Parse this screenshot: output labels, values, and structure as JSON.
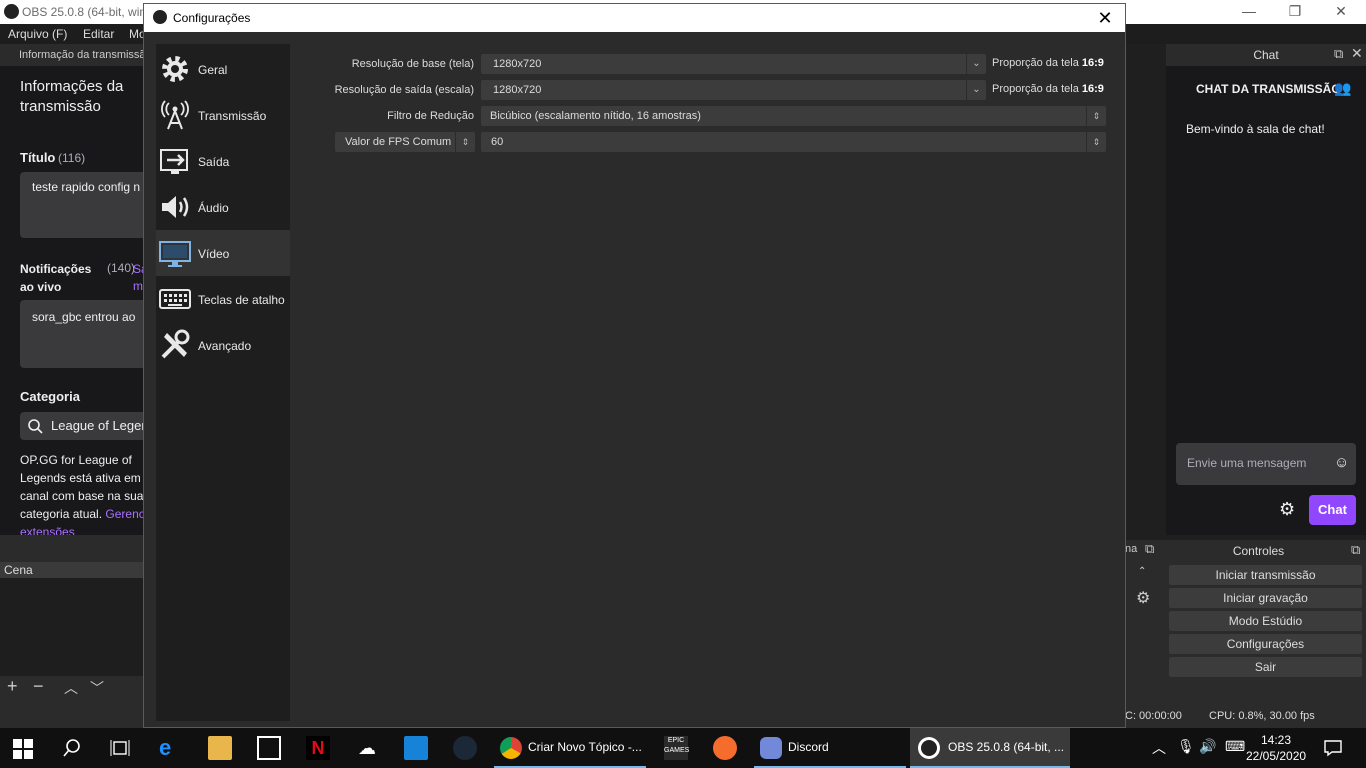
{
  "obs": {
    "window_title": "OBS 25.0.8 (64-bit, wind",
    "menu": [
      "Arquivo (F)",
      "Editar",
      "Mo"
    ],
    "left_tab": "Informação da transmissã",
    "stream_info_heading": "Informações da transmissão",
    "title_label": "Título",
    "title_count": "(116)",
    "title_value": "teste rapido config n",
    "notif_label": "Notificações ao vivo",
    "notif_count": "(140)",
    "notif_extra": "Sa m",
    "notif_value": "sora_gbc entrou ao",
    "category_label": "Categoria",
    "category_value": "League of Legen",
    "opgg_text": "OP.GG for League of Legends está ativa em canal com base na sua categoria atual.",
    "opgg_link": "Gerenc",
    "opgg_link2": "extensões",
    "scene_header": "Cena",
    "chat_tab": "Chat",
    "chat_title": "CHAT DA TRANSMISSÃO",
    "chat_welcome": "Bem-vindo à sala de chat!",
    "chat_placeholder": "Envie uma mensagem",
    "chat_send": "Chat",
    "controls_title": "Controles",
    "controls": [
      "Iniciar transmissão",
      "Iniciar gravação",
      "Modo Estúdio",
      "Configurações",
      "Sair"
    ],
    "mid_label": "na",
    "status_rec": "C: 00:00:00",
    "status_cpu": "CPU: 0.8%, 30.00 fps"
  },
  "dialog": {
    "title": "Configurações",
    "nav": [
      {
        "label": "Geral",
        "icon": "gear-icon"
      },
      {
        "label": "Transmissão",
        "icon": "antenna-icon"
      },
      {
        "label": "Saída",
        "icon": "output-icon"
      },
      {
        "label": "Áudio",
        "icon": "speaker-icon"
      },
      {
        "label": "Vídeo",
        "icon": "monitor-icon"
      },
      {
        "label": "Teclas de atalho",
        "icon": "keyboard-icon"
      },
      {
        "label": "Avançado",
        "icon": "tools-icon"
      }
    ],
    "selected": "Vídeo",
    "base_res_label": "Resolução de base (tela)",
    "base_res_value": "1280x720",
    "output_res_label": "Resolução de saída (escala)",
    "output_res_value": "1280x720",
    "ratio_prefix": "Proporção da tela",
    "ratio_value": "16:9",
    "filter_label": "Filtro de Redução",
    "filter_value": "Bicúbico (escalamento nítido, 16 amostras)",
    "fps_type": "Valor de FPS Comum",
    "fps_value": "60"
  },
  "taskbar": {
    "apps": [
      "Criar Novo Tópico -...",
      "Discord",
      "OBS 25.0.8 (64-bit, ..."
    ],
    "time": "14:23",
    "date": "22/05/2020"
  },
  "colors": {
    "accent": "#9147ff",
    "dialog_bg": "#2b2b2b",
    "nav_bg": "#1e1e1e"
  }
}
